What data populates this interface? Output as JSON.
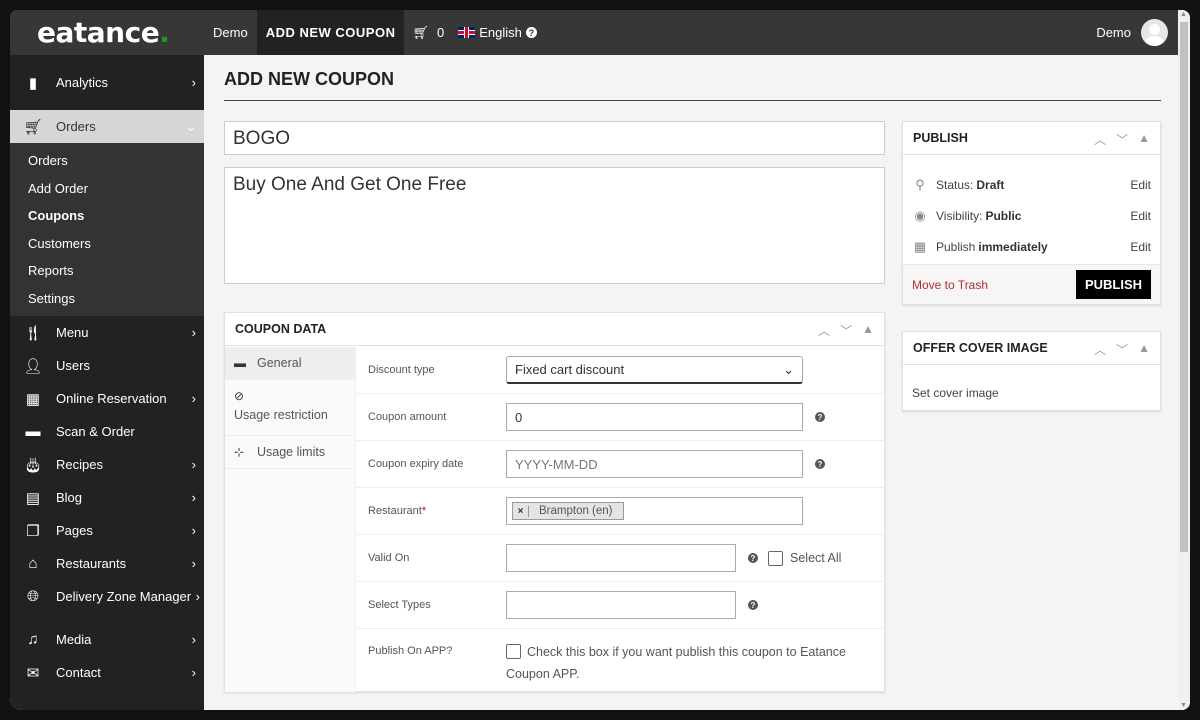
{
  "brand": {
    "name": "eatance",
    "dot": ".",
    "accent": "#1a9b1a"
  },
  "topbar": {
    "demo_link": "Demo",
    "current_page": "ADD NEW COUPON",
    "cart_count": "0",
    "language": "English",
    "user_name": "Demo"
  },
  "sidebar": {
    "analytics": "Analytics",
    "orders": "Orders",
    "orders_sub": [
      "Orders",
      "Add Order",
      "Coupons",
      "Customers",
      "Reports",
      "Settings"
    ],
    "items": [
      {
        "label": "Menu",
        "icon": "utensils-icon",
        "chevron": true
      },
      {
        "label": "Users",
        "icon": "user-icon",
        "chevron": false
      },
      {
        "label": "Online Reservation",
        "icon": "calendar-icon",
        "chevron": true
      },
      {
        "label": "Scan & Order",
        "icon": "scan-icon",
        "chevron": false
      },
      {
        "label": "Recipes",
        "icon": "cake-icon",
        "chevron": true
      },
      {
        "label": "Blog",
        "icon": "blog-icon",
        "chevron": true
      },
      {
        "label": "Pages",
        "icon": "pages-icon",
        "chevron": true
      },
      {
        "label": "Restaurants",
        "icon": "store-icon",
        "chevron": true
      },
      {
        "label": "Delivery Zone Manager",
        "icon": "globe-icon",
        "chevron": true
      },
      {
        "label": "Media",
        "icon": "media-icon",
        "chevron": true
      },
      {
        "label": "Contact",
        "icon": "mail-icon",
        "chevron": true
      }
    ]
  },
  "page": {
    "title": "ADD NEW COUPON",
    "coupon_code": "BOGO",
    "description": "Buy One And Get One Free"
  },
  "coupon_data": {
    "title": "COUPON DATA",
    "tabs": [
      "General",
      "Usage restriction",
      "Usage limits"
    ],
    "fields": {
      "discount_type_label": "Discount type",
      "discount_type_value": "Fixed cart discount",
      "amount_label": "Coupon amount",
      "amount_value": "0",
      "expiry_label": "Coupon expiry date",
      "expiry_placeholder": "YYYY-MM-DD",
      "restaurant_label": "Restaurant",
      "restaurant_tag": "Brampton (en)",
      "valid_on_label": "Valid On",
      "select_all": "Select All",
      "select_types_label": "Select Types",
      "publish_app_label": "Publish On APP?",
      "publish_app_text": "Check this box if you want publish this coupon to Eatance Coupon APP."
    }
  },
  "publish": {
    "title": "PUBLISH",
    "status_label": "Status:",
    "status_value": "Draft",
    "visibility_label": "Visibility:",
    "visibility_value": "Public",
    "publish_label": "Publish",
    "publish_value": "immediately",
    "edit": "Edit",
    "trash": "Move to Trash",
    "button": "PUBLISH"
  },
  "cover": {
    "title": "OFFER COVER IMAGE",
    "link": "Set cover image"
  }
}
